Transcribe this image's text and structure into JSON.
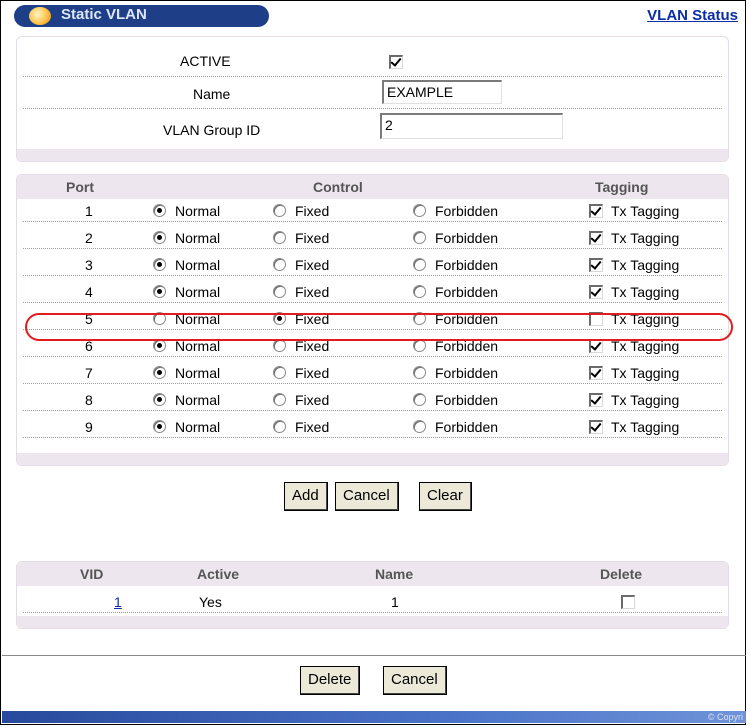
{
  "header": {
    "title": "Static VLAN",
    "status_link": "VLAN Status"
  },
  "settings": {
    "active_label": "ACTIVE",
    "active_checked": true,
    "name_label": "Name",
    "name_value": "EXAMPLE",
    "group_label": "VLAN Group ID",
    "group_value": "2"
  },
  "ports_table": {
    "headers": {
      "port": "Port",
      "control": "Control",
      "tagging": "Tagging"
    },
    "options": {
      "normal": "Normal",
      "fixed": "Fixed",
      "forbidden": "Forbidden",
      "tagging": "Tx Tagging"
    },
    "rows": [
      {
        "port": "1",
        "control": "normal",
        "tagging": true
      },
      {
        "port": "2",
        "control": "normal",
        "tagging": true
      },
      {
        "port": "3",
        "control": "normal",
        "tagging": true
      },
      {
        "port": "4",
        "control": "normal",
        "tagging": true
      },
      {
        "port": "5",
        "control": "fixed",
        "tagging": false
      },
      {
        "port": "6",
        "control": "normal",
        "tagging": true
      },
      {
        "port": "7",
        "control": "normal",
        "tagging": true
      },
      {
        "port": "8",
        "control": "normal",
        "tagging": true
      },
      {
        "port": "9",
        "control": "normal",
        "tagging": true
      }
    ]
  },
  "actions": {
    "add": "Add",
    "cancel": "Cancel",
    "clear": "Clear"
  },
  "vlan_list": {
    "headers": {
      "vid": "VID",
      "active": "Active",
      "name": "Name",
      "delete": "Delete"
    },
    "rows": [
      {
        "vid": "1",
        "active": "Yes",
        "name": "1",
        "delete_checked": false
      }
    ]
  },
  "bottom_actions": {
    "delete": "Delete",
    "cancel": "Cancel"
  },
  "footer": {
    "copyright": "© Copyri"
  },
  "colors": {
    "title_bg": "#1e3f88",
    "link": "#0b2ea8",
    "highlight": "#e01c1c",
    "band": "#ede6ee"
  }
}
